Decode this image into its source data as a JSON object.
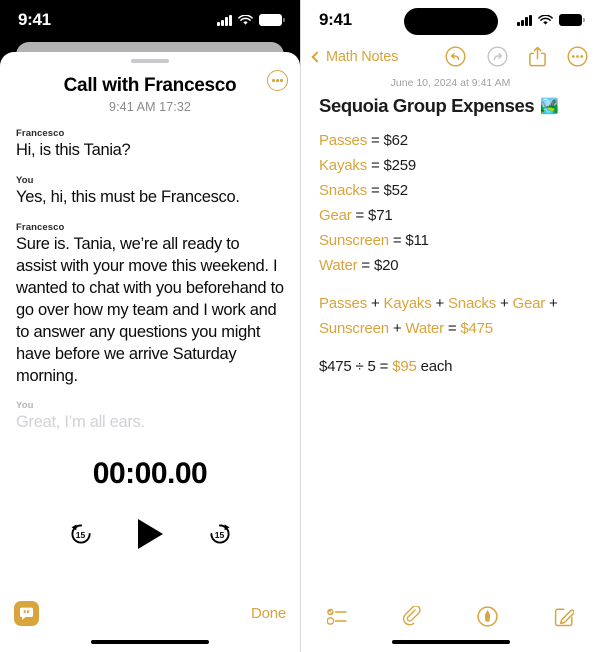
{
  "theme": {
    "accent": "#D9A43C",
    "disabled_grey": "#C4C4C8",
    "faded_text": "#D2D2D6"
  },
  "left_phone": {
    "status_bar": {
      "time": "9:41",
      "icons": [
        "cellular-signal-icon",
        "wifi-icon",
        "battery-icon"
      ]
    },
    "sheet": {
      "grabber": "sheet-grabber",
      "title": "Call with Francesco",
      "subtitle": "9:41 AM  17:32",
      "more_button": "more-options-button"
    },
    "transcript": [
      {
        "speaker": "Francesco",
        "text": "Hi, is this Tania?",
        "faded": false
      },
      {
        "speaker": "You",
        "text": "Yes, hi, this must be Francesco.",
        "faded": false
      },
      {
        "speaker": "Francesco",
        "text": "Sure is. Tania, we’re all ready to assist with your move this weekend. I wanted to chat with you beforehand to go over how my team and I work and to answer any questions you might have before we arrive Saturday morning.",
        "faded": false
      },
      {
        "speaker": "You",
        "text": "Great, I’m all ears.",
        "faded": true
      }
    ],
    "player": {
      "elapsed": "00:00.00",
      "skip_back_label": "15",
      "skip_forward_label": "15",
      "play_button": "play-button"
    },
    "bottom_bar": {
      "transcript_toggle": "transcript-toggle-button",
      "done_label": "Done"
    }
  },
  "right_phone": {
    "status_bar": {
      "time": "9:41",
      "icons": [
        "cellular-signal-icon",
        "wifi-icon",
        "battery-icon"
      ]
    },
    "nav": {
      "back_label": "Math Notes",
      "actions": [
        {
          "name": "undo-button",
          "enabled": true
        },
        {
          "name": "redo-button",
          "enabled": false
        },
        {
          "name": "share-button",
          "enabled": true
        },
        {
          "name": "more-button",
          "enabled": true
        }
      ]
    },
    "note": {
      "date": "June 10, 2024 at 9:41 AM",
      "title": "Sequoia Group Expenses",
      "title_emoji": "🏞️",
      "assignments": [
        {
          "variable": "Passes",
          "value": "= $62"
        },
        {
          "variable": "Kayaks",
          "value": "= $259"
        },
        {
          "variable": "Snacks",
          "value": "= $52"
        },
        {
          "variable": "Gear",
          "value": "= $71"
        },
        {
          "variable": "Sunscreen",
          "value": "= $11"
        },
        {
          "variable": "Water",
          "value": "= $20"
        }
      ],
      "sum_line_1_parts": [
        "Passes",
        " + ",
        "Kayaks",
        " + ",
        "Snacks",
        " + ",
        "Gear",
        " +"
      ],
      "sum_line_2_parts": [
        "Sunscreen",
        " + ",
        "Water",
        " = ",
        "$475"
      ],
      "division_line": {
        "prefix": "$475 ÷ 5 = ",
        "result": "$95",
        "suffix": " each"
      }
    },
    "toolbar": [
      {
        "name": "checklist-button"
      },
      {
        "name": "attachment-button"
      },
      {
        "name": "markup-button"
      },
      {
        "name": "compose-button"
      }
    ]
  }
}
